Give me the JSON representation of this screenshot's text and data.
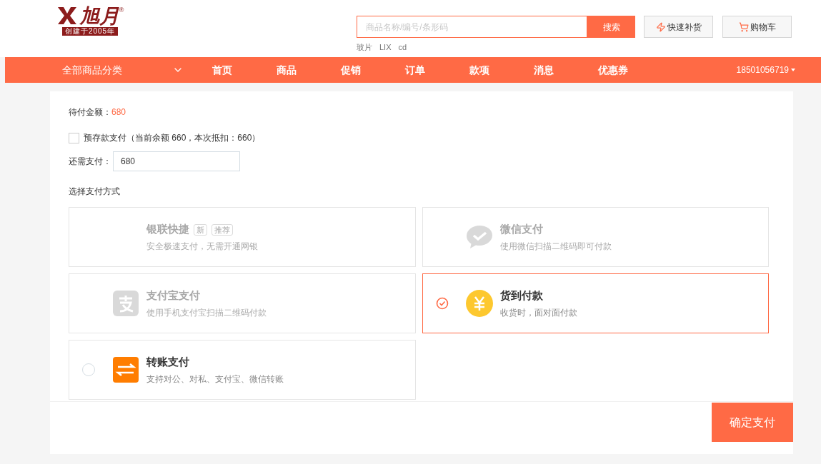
{
  "logo": {
    "name": "旭月",
    "tagline": "创建于2005年",
    "mark": "®"
  },
  "search": {
    "placeholder": "商品名称/编号/条形码",
    "button": "搜索",
    "hot": [
      "玻片",
      "LIX",
      "cd"
    ]
  },
  "header_buttons": [
    {
      "kind": "bolt",
      "label": "快速补货"
    },
    {
      "kind": "cart",
      "label": "购物车"
    }
  ],
  "nav": {
    "category": "全部商品分类",
    "items": [
      "首页",
      "商品",
      "促销",
      "订单",
      "款项",
      "消息",
      "优惠券"
    ],
    "user": "18501056719"
  },
  "payment": {
    "due_label": "待付金额：",
    "due": "680",
    "deposit": {
      "label": "预存款支付（当前余额 660，本次抵扣：660）",
      "checked": false
    },
    "remaining_label": "还需支付：",
    "remaining": "680",
    "methods_title": "选择支付方式",
    "methods": [
      {
        "kind": "unionpay",
        "title": "银联快捷",
        "tags": [
          "新",
          "推荐"
        ],
        "desc": "安全极速支付，无需开通网银",
        "disabled": true,
        "selected": false
      },
      {
        "kind": "wechat",
        "title": "微信支付",
        "desc": "使用微信扫描二维码即可付款",
        "disabled": true,
        "selected": false
      },
      {
        "kind": "alipay",
        "title": "支付宝支付",
        "desc": "使用手机支付宝扫描二维码付款",
        "disabled": true,
        "selected": false
      },
      {
        "kind": "cod",
        "title": "货到付款",
        "desc": "收货时，面对面付款",
        "disabled": false,
        "selected": true
      },
      {
        "kind": "transfer",
        "title": "转账支付",
        "desc": "支持对公、对私、支付宝、微信转账",
        "disabled": false,
        "selected": false
      }
    ],
    "confirm": "确定支付"
  }
}
